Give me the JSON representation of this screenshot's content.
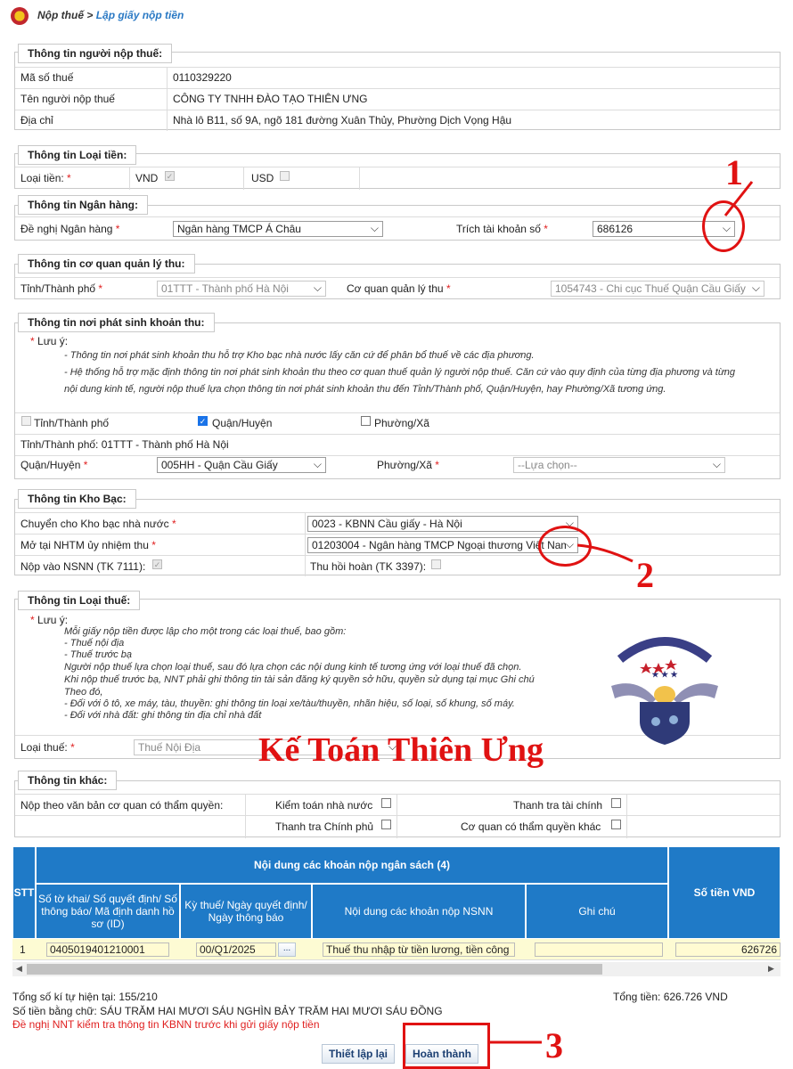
{
  "breadcrumb": {
    "root": "Nộp thuế",
    "sep": " > ",
    "current": "Lập giấy nộp tiền"
  },
  "taxpayer": {
    "legend": "Thông tin người nộp thuế:",
    "mst_label": "Mã số thuế",
    "mst_value": "0110329220",
    "name_label": "Tên người nộp thuế",
    "name_value": "CÔNG TY TNHH ĐÀO TẠO THIÊN ƯNG",
    "addr_label": "Địa chỉ",
    "addr_value": "Nhà lô B11, số 9A, ngõ 181 đường Xuân Thủy, Phường Dịch Vọng Hậu"
  },
  "currency": {
    "legend": "Thông tin Loại tiền:",
    "label": "Loại tiền:",
    "vnd": "VND",
    "usd": "USD",
    "vnd_checked": true,
    "usd_checked": false
  },
  "bank": {
    "legend": "Thông tin Ngân hàng:",
    "label": "Đề nghị Ngân hàng",
    "value": "Ngân hàng TMCP Á Châu",
    "account_label": "Trích tài khoản số",
    "account_value": "686126"
  },
  "authority": {
    "legend": "Thông tin cơ quan quản lý thu:",
    "province_label": "Tỉnh/Thành phố",
    "province_value": "01TTT - Thành phố Hà Nội",
    "agency_label": "Cơ quan quản lý thu",
    "agency_value": "1054743 - Chi cục Thuế Quận Cầu Giấy"
  },
  "origin": {
    "legend": "Thông tin nơi phát sinh khoản thu:",
    "note_title": "Lưu ý:",
    "note_1": "- Thông tin nơi phát sinh khoản thu hỗ trợ Kho bạc nhà nước lấy căn cứ để phân bổ thuế về các địa phương.",
    "note_2a": "- Hệ thống hỗ trợ mặc định thông tin nơi phát sinh khoản thu theo cơ quan thuế quản lý người nộp thuế. Căn cứ vào quy định của từng địa phương và từng",
    "note_2b": "nội dung kinh tế, người nộp thuế lựa chọn thông tin nơi phát sinh khoản thu đến Tỉnh/Thành phố, Quận/Huyện, hay Phường/Xã tương ứng.",
    "opt_province": "Tỉnh/Thành phố",
    "opt_district": "Quận/Huyện",
    "opt_ward": "Phường/Xã",
    "province_line": "Tỉnh/Thành phố: 01TTT - Thành phố Hà Nội",
    "district_label": "Quận/Huyện",
    "district_value": "005HH - Quận Cầu Giấy",
    "ward_label": "Phường/Xã",
    "ward_value": "--Lựa chọn--"
  },
  "treasury": {
    "legend": "Thông tin Kho Bạc:",
    "transfer_label": "Chuyển cho Kho bạc nhà nước",
    "transfer_value": "0023 - KBNN Cầu giấy - Hà Nội",
    "open_label": "Mở tại NHTM ủy nhiệm thu",
    "open_value": "01203004 - Ngân hàng TMCP Ngoại thương Việt Nam",
    "nsnn_label": "Nộp vào NSNN (TK 7111):",
    "refund_label": "Thu hồi hoàn (TK 3397):"
  },
  "taxtype": {
    "legend": "Thông tin Loại thuế:",
    "note_title": "Lưu ý:",
    "lines": [
      "Mỗi giấy nộp tiền được lập cho một trong các loại thuế, bao gồm:",
      "- Thuế nội địa",
      "- Thuế trước bạ",
      "Người nộp thuế lựa chọn loại thuế, sau đó lựa chọn các nội dung kinh tế tương ứng với loại thuế đã chọn.",
      "Khi nộp thuế trước bạ, NNT phải ghi thông tin tài sản đăng ký quyền sở hữu, quyền sử dụng tại mục Ghi chú",
      "Theo đó,",
      "- Đối với ô tô, xe máy, tàu, thuyền: ghi thông tin loại xe/tàu/thuyền, nhãn hiệu, số loại, số khung, số máy.",
      "- Đối với nhà đất: ghi thông tin địa chỉ nhà đất"
    ],
    "label": "Loại thuế:",
    "value": "Thuế Nội Địa"
  },
  "other": {
    "legend": "Thông tin khác:",
    "label": "Nộp theo văn bản cơ quan có thẩm quyền:",
    "opt1": "Kiểm toán nhà nước",
    "opt2": "Thanh tra tài chính",
    "opt3": "Thanh tra Chính phủ",
    "opt4": "Cơ quan có thẩm quyền khác"
  },
  "table": {
    "stt": "STT",
    "group": "Nội dung các khoản nộp ngân sách (4)",
    "col1": "Số tờ khai/ Số quyết định/ Số thông báo/ Mã định danh hồ sơ (ID)",
    "col2": "Kỳ thuế/ Ngày quyết định/ Ngày thông báo",
    "col3": "Nội dung các khoản nộp NSNN",
    "col4": "Ghi chú",
    "amount": "Số tiền VND",
    "row": {
      "stt": "1",
      "doc": "0405019401210001",
      "period": "00/Q1/2025",
      "dots": "...",
      "content": "Thuế thu nhập từ tiền lương, tiền công",
      "note": "",
      "amount": "626726"
    }
  },
  "summary": {
    "chars": "Tổng số kí tự hiện tại: 155/210",
    "total": "Tổng tiền: 626.726 VND",
    "words": "Số tiền bằng chữ: SÁU TRĂM HAI MƯƠI SÁU NGHÌN BẢY TRĂM HAI MƯƠI SÁU ĐỒNG",
    "warning": "Đề nghị NNT kiểm tra thông tin KBNN trước khi gửi giấy nộp tiền"
  },
  "buttons": {
    "reset": "Thiết lập lại",
    "finish": "Hoàn thành"
  },
  "watermark": {
    "brand": "Kế Toán Thiên Ưng",
    "logo_text": "CÔNG TY TNHH DỊCH VỤ ĐÀO TẠO THIÊN ỨNG · KẾ TOÁN THIÊN ỨNG"
  },
  "annotations": {
    "n1": "1",
    "n2": "2",
    "n3": "3"
  },
  "colors": {
    "header_blue": "#1f7ac7",
    "annotation_red": "#e01212",
    "row_yellow": "#fdfbd3"
  }
}
